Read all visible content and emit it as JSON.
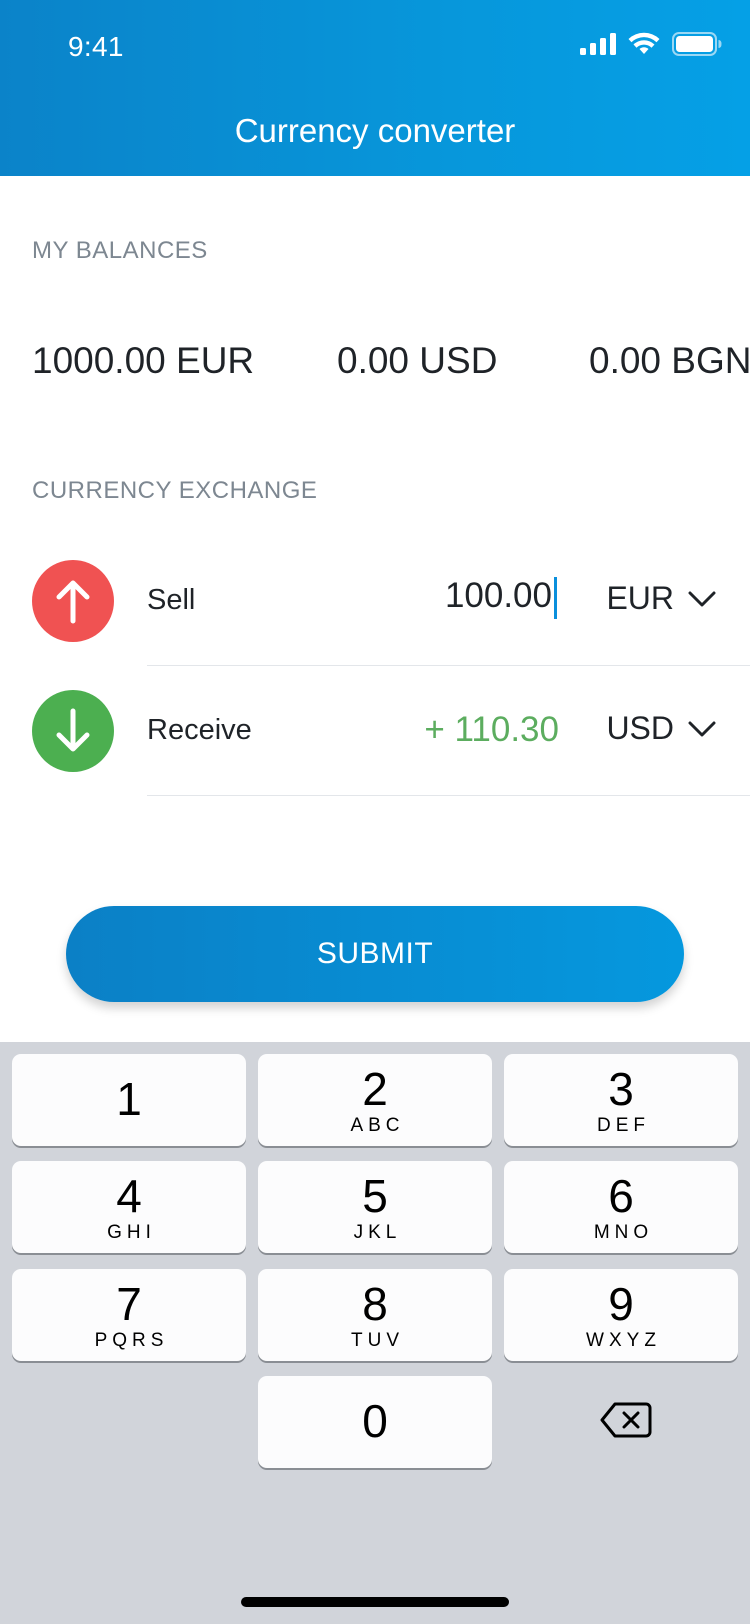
{
  "status_bar": {
    "time": "9:41"
  },
  "header": {
    "title": "Currency converter"
  },
  "balances": {
    "label": "MY BALANCES",
    "items": [
      "1000.00 EUR",
      "0.00 USD",
      "0.00 BGN"
    ]
  },
  "exchange": {
    "label": "CURRENCY EXCHANGE",
    "sell": {
      "label": "Sell",
      "amount": "100.00",
      "currency": "EUR"
    },
    "receive": {
      "label": "Receive",
      "amount": "+ 110.30",
      "currency": "USD"
    }
  },
  "submit": {
    "label": "SUBMIT"
  },
  "keyboard": {
    "keys": [
      {
        "digit": "1",
        "letters": ""
      },
      {
        "digit": "2",
        "letters": "ABC"
      },
      {
        "digit": "3",
        "letters": "DEF"
      },
      {
        "digit": "4",
        "letters": "GHI"
      },
      {
        "digit": "5",
        "letters": "JKL"
      },
      {
        "digit": "6",
        "letters": "MNO"
      },
      {
        "digit": "7",
        "letters": "PQRS"
      },
      {
        "digit": "8",
        "letters": "TUV"
      },
      {
        "digit": "9",
        "letters": "WXYZ"
      },
      {
        "digit": "0",
        "letters": ""
      }
    ]
  },
  "colors": {
    "accent": "#0797db",
    "sell": "#f05252",
    "receive": "#4caf50",
    "receive_text": "#5cad5f"
  }
}
